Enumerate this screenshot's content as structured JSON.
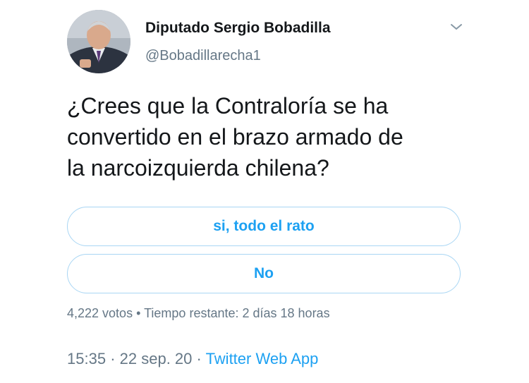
{
  "author": {
    "name": "Diputado Sergio Bobadilla",
    "handle": "@Bobadillarecha1",
    "avatar": "person-photo"
  },
  "menu": {
    "icon": "chevron-down-icon"
  },
  "tweet": {
    "text_lines": [
      "¿Crees que la Contraloría se ha",
      "convertido en el brazo armado de",
      "la narcoizquierda chilena?"
    ]
  },
  "poll": {
    "options": [
      {
        "label": "si, todo el rato"
      },
      {
        "label": "No"
      }
    ],
    "votes": "4,222 votos",
    "separator": "•",
    "time_left": "Tiempo restante: 2 días 18 horas"
  },
  "footer": {
    "time": "15:35",
    "separator1": "·",
    "date": "22 sep. 20",
    "separator2": "·",
    "source": "Twitter Web App"
  },
  "colors": {
    "accent": "#1da1f2",
    "secondary_text": "#657786",
    "poll_border": "#a9d6f4"
  }
}
